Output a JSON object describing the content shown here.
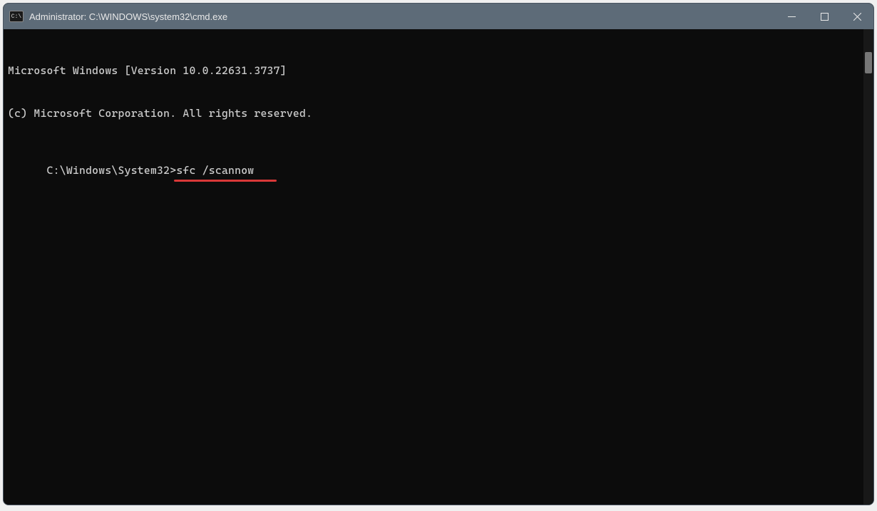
{
  "window": {
    "title": "Administrator: C:\\WINDOWS\\system32\\cmd.exe",
    "icon_name": "cmd-icon"
  },
  "terminal": {
    "line1": "Microsoft Windows [Version 10.0.22631.3737]",
    "line2": "(c) Microsoft Corporation. All rights reserved.",
    "blank": "",
    "prompt": "C:\\Windows\\System32>",
    "command": "sfc /scannow"
  },
  "annotation": {
    "underline_color": "#d93838"
  }
}
